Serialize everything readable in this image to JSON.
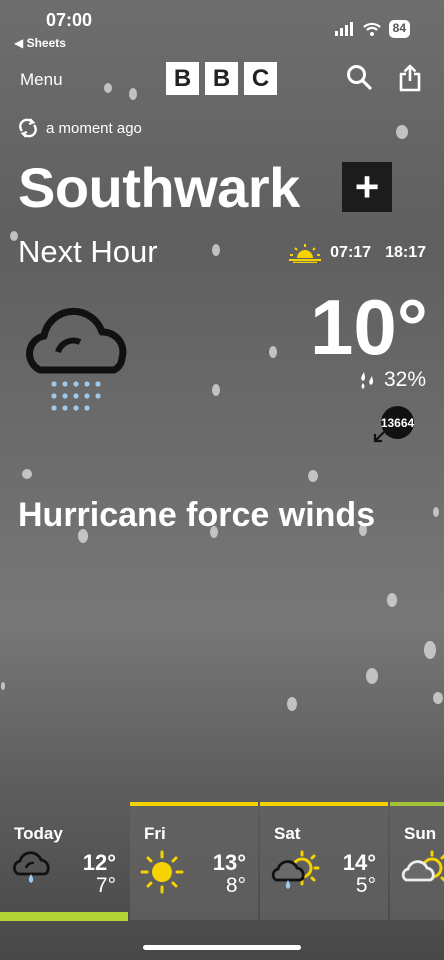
{
  "status": {
    "time": "07:00",
    "back_label": "◀ Sheets",
    "battery": "84"
  },
  "nav": {
    "menu_label": "Menu",
    "logo": [
      "B",
      "B",
      "C"
    ]
  },
  "updated": "a moment ago",
  "location": "Southwark",
  "period": "Next Hour",
  "sunrise": "07:17",
  "sunset": "18:17",
  "temperature": "10°",
  "humidity": "32%",
  "wind_speed": "13664",
  "summary": "Hurricane force winds",
  "forecast": [
    {
      "day": "Today",
      "high": "12°",
      "low": "7°",
      "icon": "light-rain-cloud-icon"
    },
    {
      "day": "Fri",
      "high": "13°",
      "low": "8°",
      "icon": "sunny-icon"
    },
    {
      "day": "Sat",
      "high": "14°",
      "low": "5°",
      "icon": "sunny-intervals-light-rain-icon"
    },
    {
      "day": "Sun",
      "high": "",
      "low": "",
      "icon": "sunny-intervals-icon"
    }
  ],
  "colors": {
    "sun": "#f5d300",
    "today_bar": "#b4d335",
    "rain": "#9dc9ec"
  }
}
